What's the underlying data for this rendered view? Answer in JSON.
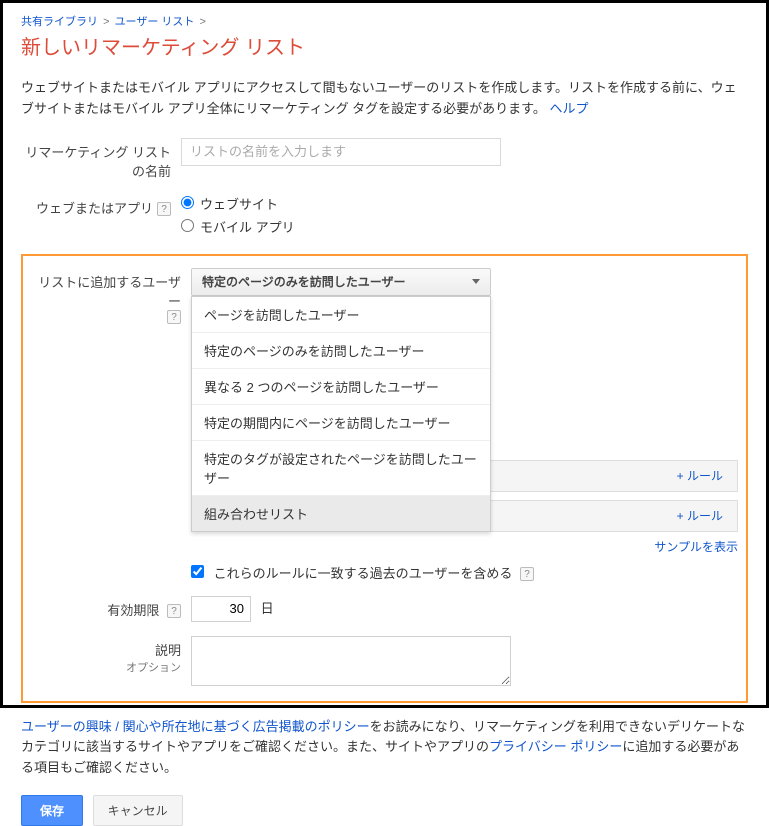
{
  "breadcrumb": {
    "shared_library": "共有ライブラリ",
    "user_list": "ユーザー リスト"
  },
  "page_title": "新しいリマーケティング リスト",
  "intro": {
    "text1": "ウェブサイトまたはモバイル アプリにアクセスして間もないユーザーのリストを作成します。リストを作成する前に、ウェブサイトまたはモバイル アプリ全体にリマーケティング タグを設定する必要があります。",
    "help_link": "ヘルプ"
  },
  "labels": {
    "list_name": "リマーケティング リストの名前",
    "web_or_app": "ウェブまたはアプリ",
    "add_users": "リストに追加するユーザー",
    "duration": "有効期限",
    "description": "説明",
    "description_sub": "オプション"
  },
  "placeholders": {
    "list_name": "リストの名前を入力します"
  },
  "radios": {
    "website": "ウェブサイト",
    "mobile_app": "モバイル アプリ"
  },
  "dropdown": {
    "selected": "特定のページのみを訪問したユーザー",
    "options": {
      "o1": "ページを訪問したユーザー",
      "o2": "特定のページのみを訪問したユーザー",
      "o3": "異なる 2 つのページを訪問したユーザー",
      "o4": "特定の期間内にページを訪問したユーザー",
      "o5": "特定のタグが設定されたページを訪問したユーザー",
      "o6": "組み合わせリスト"
    }
  },
  "rules": {
    "add_rule": "+ ルール",
    "sample": "サンプルを表示"
  },
  "checkbox": {
    "include_past": "これらのルールに一致する過去のユーザーを含める"
  },
  "duration": {
    "value": "30",
    "suffix": "日"
  },
  "footer": {
    "link1": "ユーザーの興味 / 関心や所在地に基づく広告掲載のポリシー",
    "text1": "をお読みになり、リマーケティングを利用できないデリケートなカテゴリに該当するサイトやアプリをご確認ください。また、サイトやアプリの",
    "link2": "プライバシー ポリシー",
    "text2": "に追加する必要がある項目もご確認ください。"
  },
  "buttons": {
    "save": "保存",
    "cancel": "キャンセル"
  },
  "help_q": "?"
}
